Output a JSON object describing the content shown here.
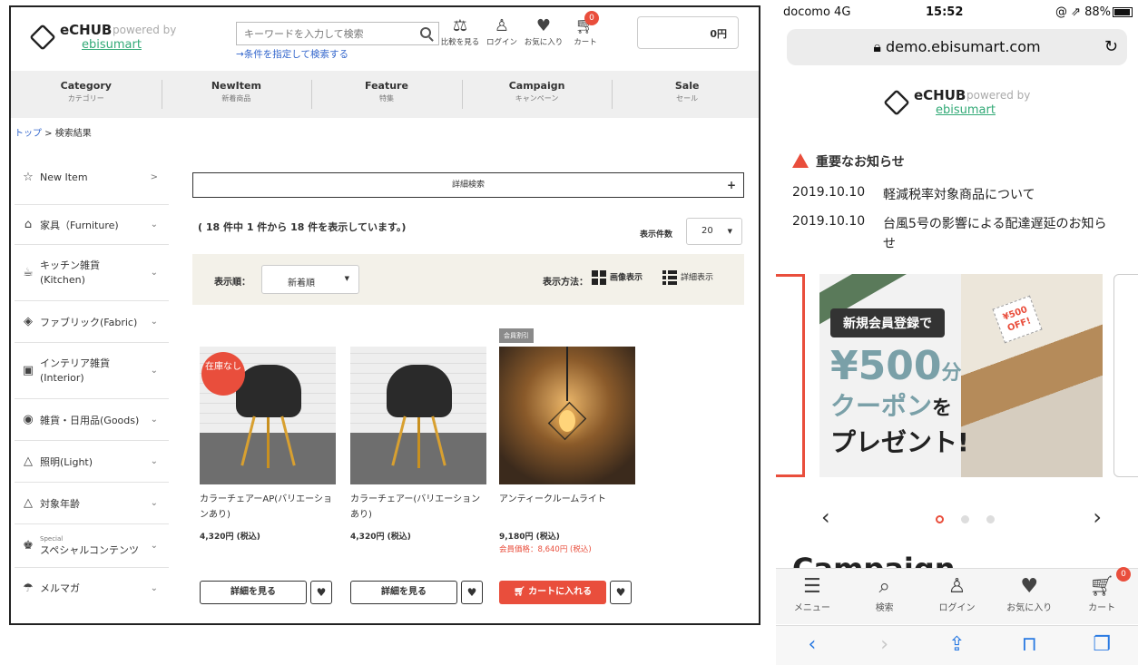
{
  "desktop": {
    "logo": {
      "name": "eCHUB",
      "powered": "powered by",
      "brand": "ebisumart"
    },
    "search": {
      "placeholder": "キーワードを入力して検索",
      "condition_link": "→条件を指定して検索する"
    },
    "header_icons": [
      {
        "icon": "scale-icon",
        "label": "比較を見る"
      },
      {
        "icon": "user-icon",
        "label": "ログイン"
      },
      {
        "icon": "heart-icon",
        "label": "お気に入り"
      },
      {
        "icon": "cart-icon",
        "label": "カート",
        "badge": "0"
      }
    ],
    "cart_total": "0円",
    "nav": [
      {
        "en": "Category",
        "ja": "カテゴリー"
      },
      {
        "en": "NewItem",
        "ja": "新着商品"
      },
      {
        "en": "Feature",
        "ja": "特集"
      },
      {
        "en": "Campaign",
        "ja": "キャンペーン"
      },
      {
        "en": "Sale",
        "ja": "セール"
      }
    ],
    "breadcrumb": {
      "home": "トップ",
      "sep": " > ",
      "current": "検索結果"
    },
    "sidebar": [
      {
        "icon": "star-icon",
        "label": "New Item",
        "chevron": ">"
      },
      {
        "icon": "furniture-icon",
        "label": "家具（Furniture)",
        "chevron": "⌄"
      },
      {
        "icon": "kitchen-icon",
        "label": "キッチン雑貨(Kitchen)",
        "chevron": "⌄"
      },
      {
        "icon": "fabric-icon",
        "label": "ファブリック(Fabric)",
        "chevron": "⌄"
      },
      {
        "icon": "interior-icon",
        "label": "インテリア雑貨(Interior)",
        "chevron": "⌄"
      },
      {
        "icon": "goods-icon",
        "label": "雑貨・日用品(Goods)",
        "chevron": "⌄"
      },
      {
        "icon": "light-icon",
        "label": "照明(Light)",
        "chevron": "⌄"
      },
      {
        "icon": "age-icon",
        "label": "対象年齢",
        "chevron": "⌄"
      },
      {
        "icon": "special-icon",
        "label": "スペシャルコンテンツ",
        "small": "Special",
        "chevron": "⌄"
      },
      {
        "icon": "mail-icon",
        "label": "メルマガ",
        "chevron": "⌄"
      }
    ],
    "detail_search": {
      "label": "詳細検索",
      "toggle": "+"
    },
    "result_count": "( 18 件中 1 件から 18 件を表示しています。)",
    "per_page": {
      "label": "表示件数",
      "value": "20"
    },
    "sort": {
      "label": "表示順：",
      "value": "新着順"
    },
    "display": {
      "label": "表示方法：",
      "image": "画像表示",
      "list": "詳細表示"
    },
    "products": [
      {
        "name": "カラーチェアーAP(バリエーションあり)",
        "price": "4,320円 (税込)",
        "badge": "在庫なし",
        "button": "詳細を見る"
      },
      {
        "name": "カラーチェアー(バリエーションあり)",
        "price": "4,320円 (税込)",
        "button": "詳細を見る"
      },
      {
        "name": "アンティークルームライト",
        "price": "9,180円 (税込)",
        "member_price": "会員価格：8,640円 (税込)",
        "tag": "会員割引",
        "button": "カートに入れる"
      }
    ],
    "colors": {
      "accent": "#e94e3c",
      "link": "#3366cc",
      "nav_bg": "#efefef",
      "sort_bg": "#f3f1e9"
    }
  },
  "phone": {
    "status": {
      "carrier": "docomo 4G",
      "time": "15:52",
      "right": "@ ⇗ 88%"
    },
    "url": "demo.ebisumart.com",
    "notice_title": "重要なお知らせ",
    "news": [
      {
        "date": "2019.10.10",
        "text": "軽減税率対象商品について"
      },
      {
        "date": "2019.10.10",
        "text": "台風5号の影響による配達遅延のお知らせ"
      }
    ],
    "banner": {
      "pill": "新規会員登録で",
      "amount": "¥500",
      "unit": "分",
      "coupon": "クーポン",
      "wo": "を",
      "present": "プレゼント!",
      "tag": "¥500 OFF!"
    },
    "section_title": "Campaign",
    "tabbar": [
      {
        "icon": "menu-icon",
        "label": "メニュー"
      },
      {
        "icon": "search-icon",
        "label": "検索"
      },
      {
        "icon": "user-icon",
        "label": "ログイン"
      },
      {
        "icon": "heart-icon",
        "label": "お気に入り"
      },
      {
        "icon": "cart-icon",
        "label": "カート",
        "badge": "0"
      }
    ]
  }
}
